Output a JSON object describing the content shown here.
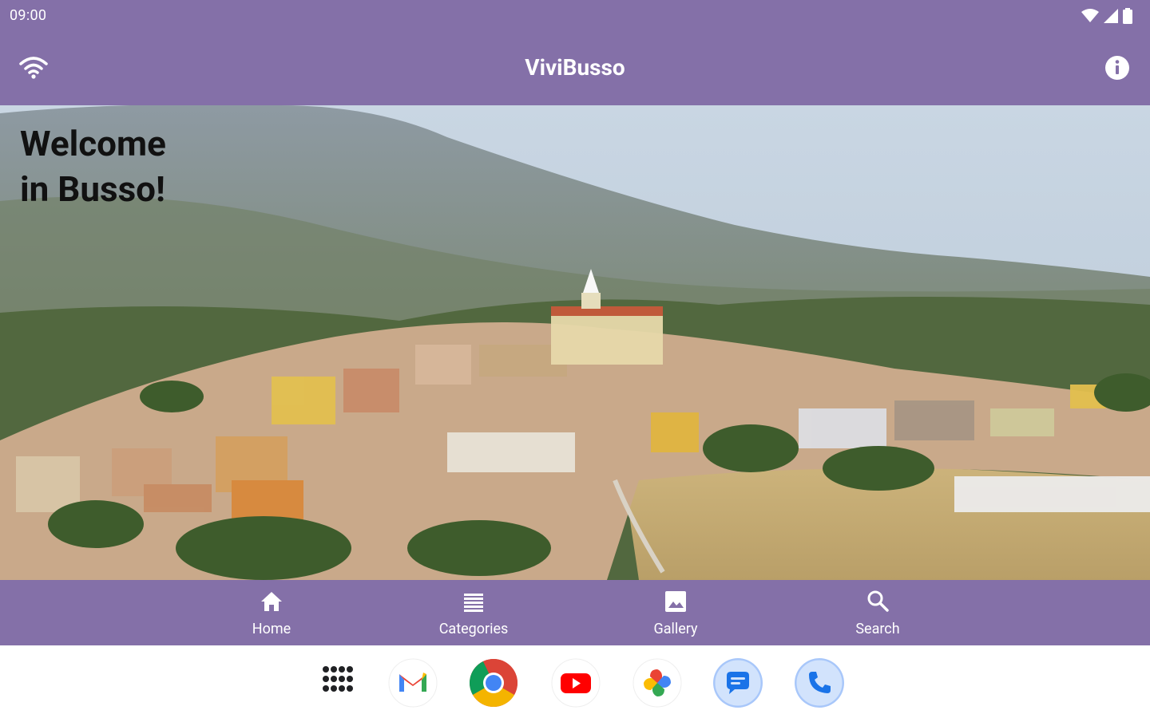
{
  "status_bar": {
    "time": "09:00",
    "icons": [
      "wifi-icon",
      "signal-icon",
      "battery-icon"
    ]
  },
  "app_bar": {
    "title": "ViviBusso",
    "left_icon": "wifi-icon",
    "right_icon": "info-icon",
    "color": "#8470a8"
  },
  "hero": {
    "heading_line1": "Welcome",
    "heading_line2": "in Busso!"
  },
  "bottom_nav": {
    "items": [
      {
        "label": "Home",
        "icon": "home-icon"
      },
      {
        "label": "Categories",
        "icon": "list-icon"
      },
      {
        "label": "Gallery",
        "icon": "image-icon"
      },
      {
        "label": "Search",
        "icon": "search-icon"
      }
    ]
  },
  "dock": {
    "apps": [
      "apps-grid-icon",
      "gmail-icon",
      "chrome-icon",
      "youtube-icon",
      "photos-icon",
      "messages-icon",
      "phone-icon"
    ]
  }
}
